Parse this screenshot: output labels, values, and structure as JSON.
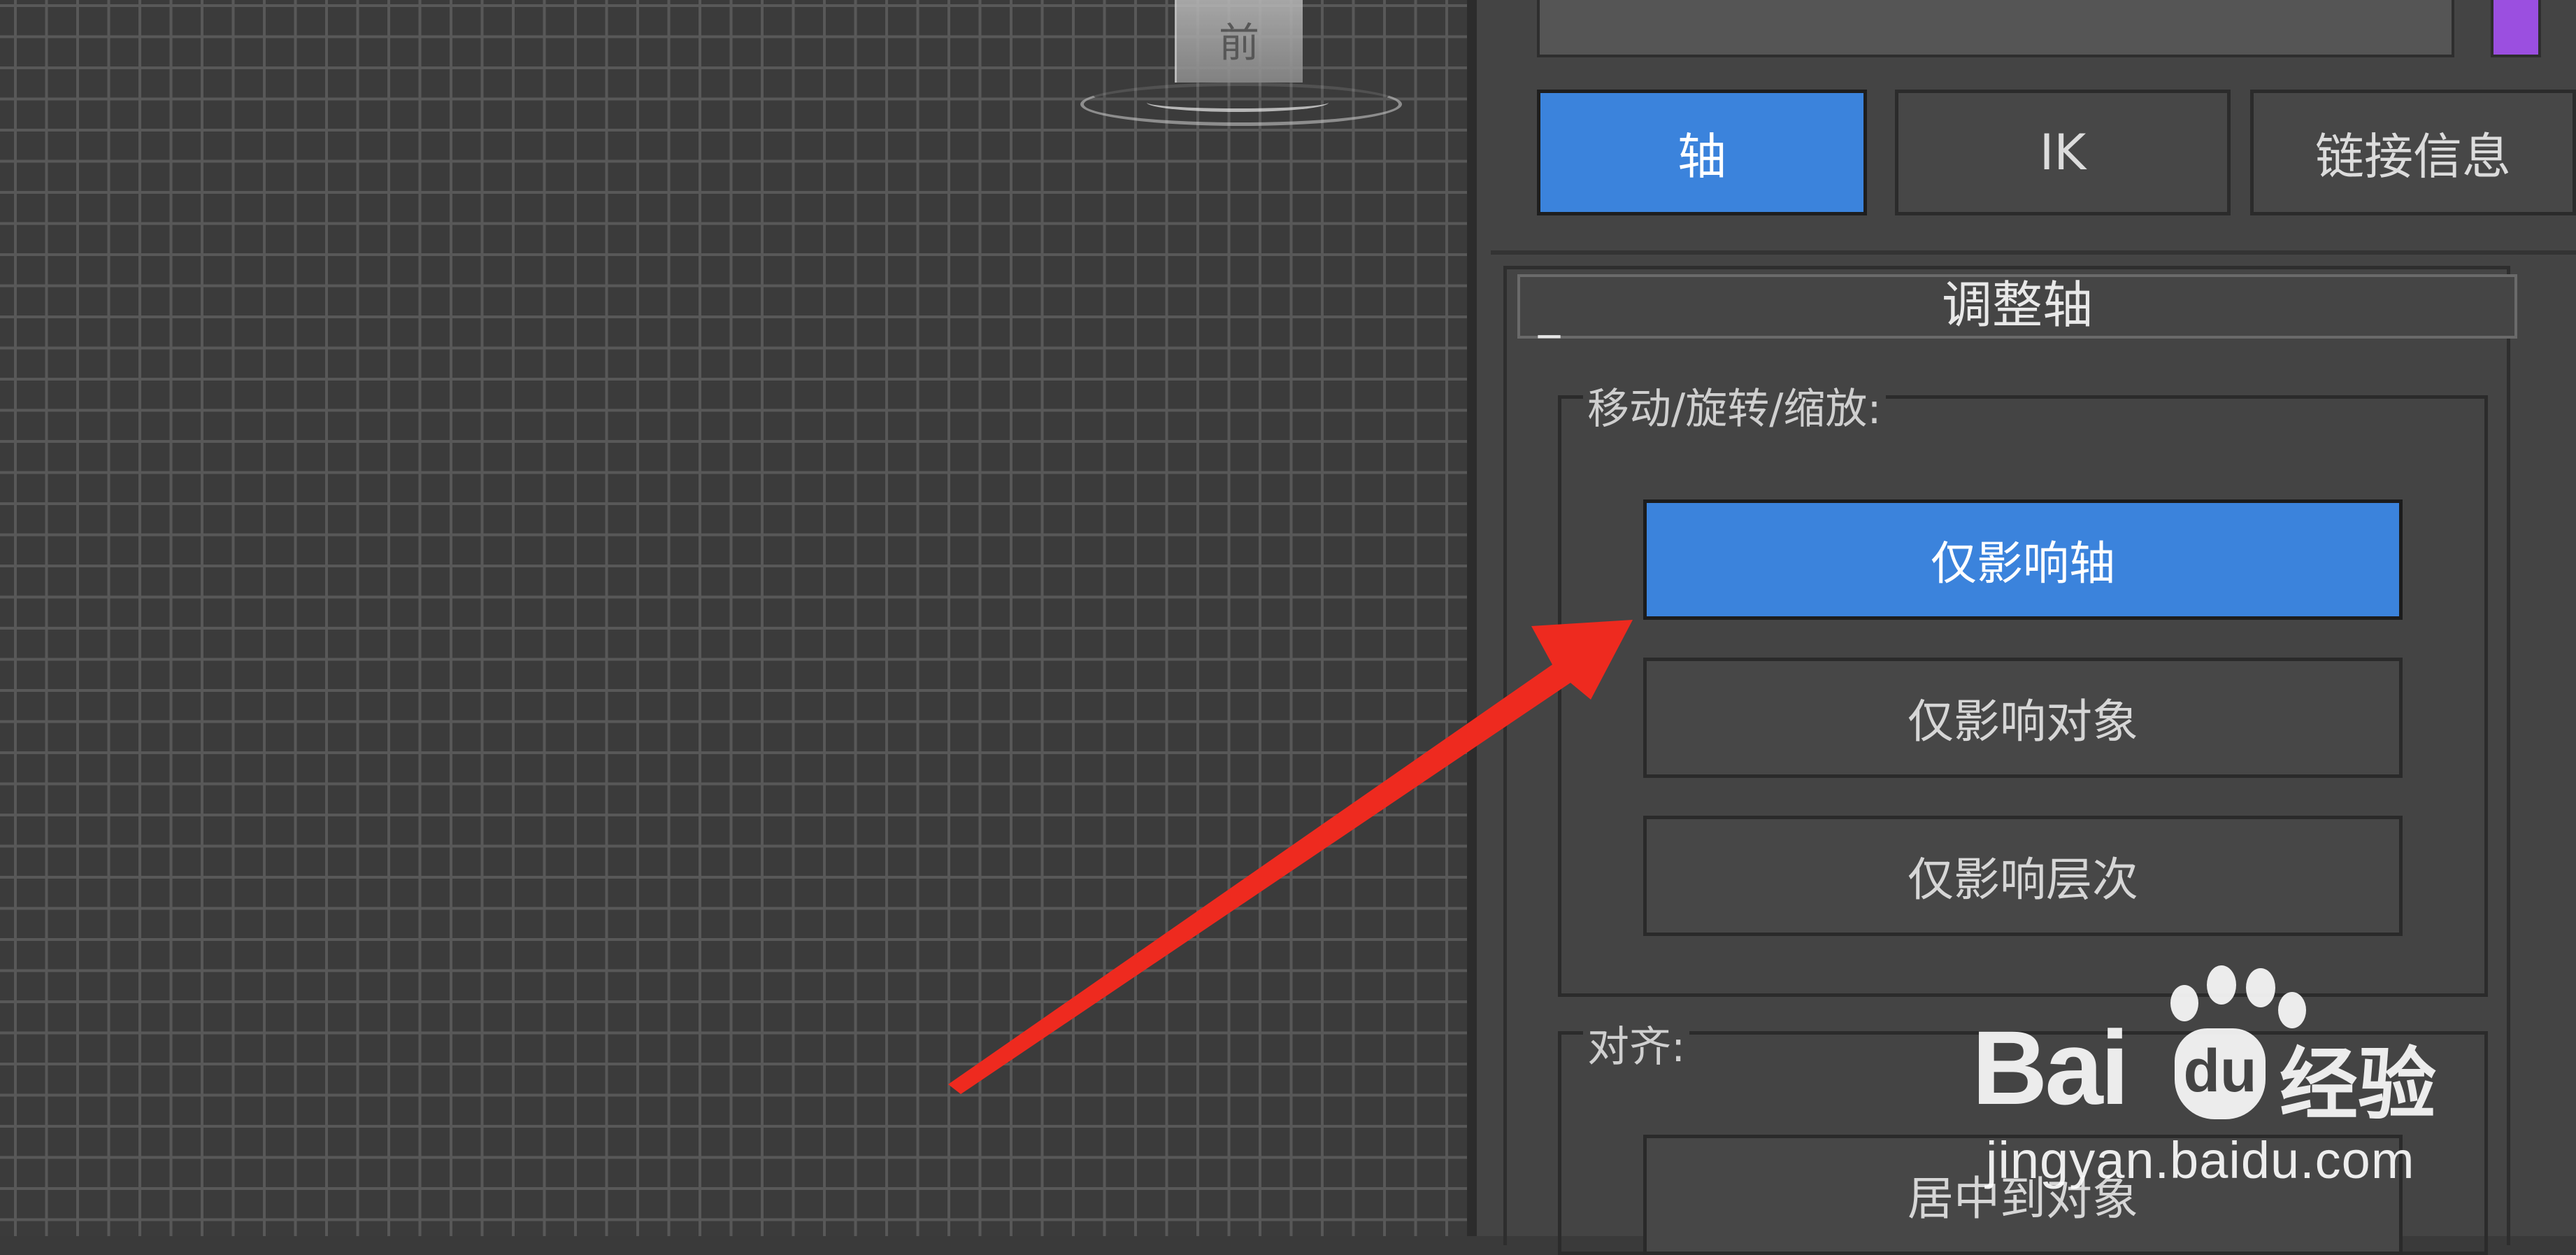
{
  "viewport": {
    "view_cube_label": "前"
  },
  "tabs": [
    {
      "label": "轴",
      "active": true
    },
    {
      "label": "IK",
      "active": false
    },
    {
      "label": "链接信息",
      "active": false
    }
  ],
  "rollout": {
    "collapse_symbol": "_",
    "title": "调整轴"
  },
  "move_rotate_scale": {
    "label": "移动/旋转/缩放:",
    "buttons": [
      {
        "label": "仅影响轴",
        "active": true
      },
      {
        "label": "仅影响对象",
        "active": false
      },
      {
        "label": "仅影响层次",
        "active": false
      }
    ]
  },
  "align": {
    "label": "对齐:",
    "buttons": [
      {
        "label": "居中到对象",
        "active": false
      }
    ]
  },
  "watermark": {
    "brand_prefix": "Bai",
    "brand_du": "du",
    "brand_suffix": "经验",
    "url": "jingyan.baidu.com"
  },
  "colors": {
    "active_blue": "#3b83dc",
    "color_swatch": "#9b4fe0",
    "arrow": "#ee2a1f"
  }
}
